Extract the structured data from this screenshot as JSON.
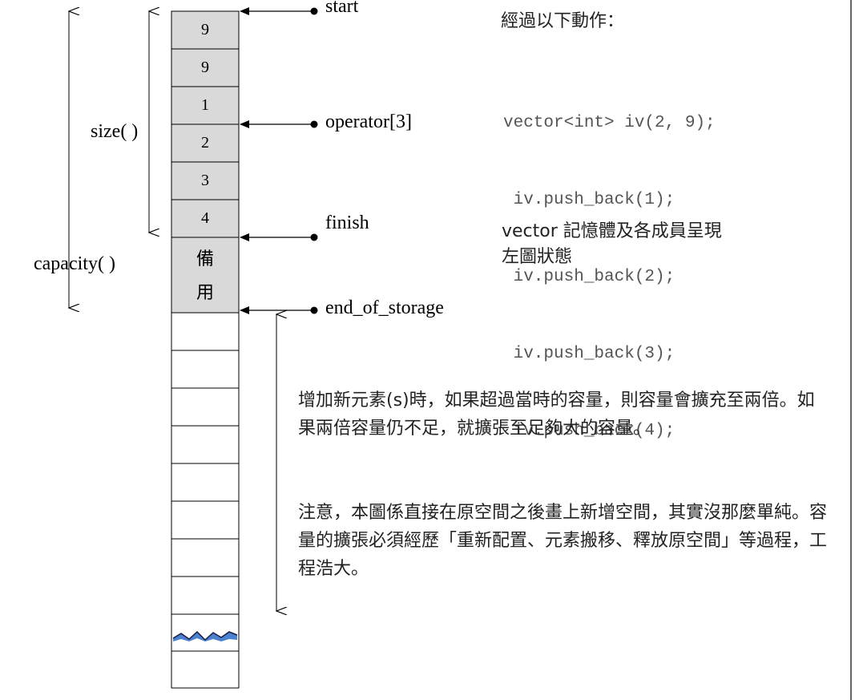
{
  "memory": {
    "used_cells": [
      "9",
      "9",
      "1",
      "2",
      "3",
      "4"
    ],
    "spare_cells": [
      "備",
      "用"
    ],
    "empty_cell_count": 10
  },
  "pointers": {
    "start": "start",
    "operator": "operator[3]",
    "finish": "finish",
    "end_of_storage": "end_of_storage"
  },
  "dimensions": {
    "size": "size( )",
    "capacity": "capacity( )"
  },
  "explanation": {
    "heading": "經過以下動作：",
    "code_lines": [
      "vector<int> iv(2, 9);",
      " iv.push_back(1);",
      " iv.push_back(2);",
      " iv.push_back(3);",
      " iv.push_back(4);"
    ],
    "state_text_1": "vector 記憶體及各成員呈現",
    "state_text_2": "左圖狀態"
  },
  "notes": {
    "growth": "增加新元素(s)時，如果超過當時的容量，則容量會擴充至兩倍。如果兩倍容量仍不足，就擴張至足夠大的容量。",
    "caution": "注意，本圖係直接在原空間之後畫上新增空間，其實沒那麼單純。容量的擴張必須經歷「重新配置、元素搬移、釋放原空間」等過程，工程浩大。"
  },
  "colors": {
    "filled_cell": "#d9d9d9",
    "empty_cell": "#ffffff",
    "break_mark": "#2c6cc8"
  }
}
